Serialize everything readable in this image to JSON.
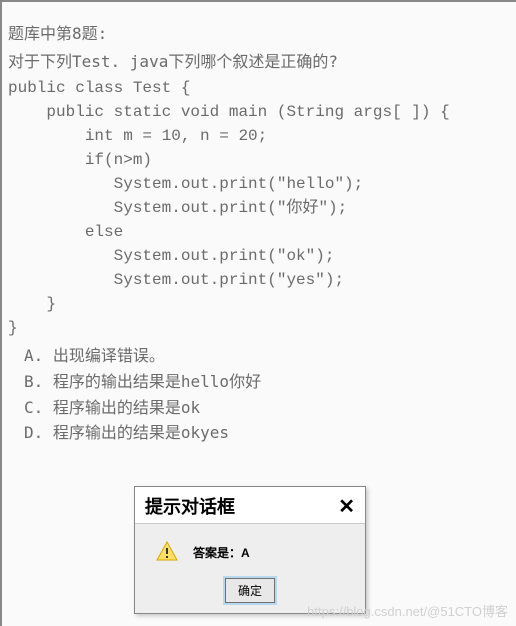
{
  "header": "题库中第8题:",
  "question": "对于下列Test. java下列哪个叙述是正确的?",
  "code": "public class Test {\n    public static void main (String args[ ]) {\n        int m = 10, n = 20;\n        if(n>m)\n           System.out.print(\"hello\");\n           System.out.print(\"你好\");\n        else\n           System.out.print(\"ok\");\n           System.out.print(\"yes\");\n    }\n}",
  "options": {
    "A": "A. 出现编译错误。",
    "B": "B. 程序的输出结果是hello你好",
    "C": "C. 程序输出的结果是ok",
    "D": "D. 程序输出的结果是okyes"
  },
  "dialog": {
    "title": "提示对话框",
    "close": "✕",
    "message": "答案是：A",
    "button": "确定"
  },
  "watermark": "https://blog.csdn.net/@51CTO博客"
}
